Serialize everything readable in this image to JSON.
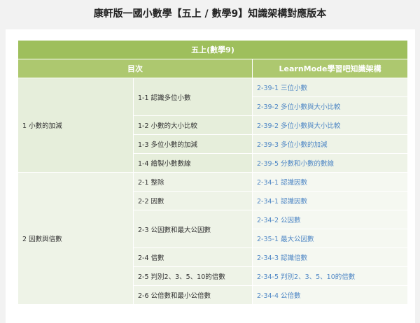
{
  "title": "康軒版一國小數學【五上 / 數學9】知識架構對應版本",
  "table": {
    "header": "五上(數學9)",
    "col_toc": "目次",
    "col_map": "LearnMode學習吧知識架構",
    "groups": [
      {
        "unit": "1 小數的加減",
        "lessons": [
          {
            "name": "1-1 認識多位小數",
            "links": [
              "2-39-1 三位小數",
              "2-39-2 多位小數與大小比較"
            ]
          },
          {
            "name": "1-2 小數的大小比較",
            "links": [
              "2-39-2 多位小數與大小比較"
            ]
          },
          {
            "name": "1-3 多位小數的加減",
            "links": [
              "2-39-3 多位小數的加減"
            ]
          },
          {
            "name": "1-4 繪製小數數線",
            "links": [
              "2-39-5 分數和小數的數線"
            ]
          }
        ]
      },
      {
        "unit": "2 因數與倍數",
        "lessons": [
          {
            "name": "2-1 整除",
            "links": [
              "2-34-1 認識因數"
            ]
          },
          {
            "name": "2-2 因數",
            "links": [
              "2-34-1 認識因數"
            ]
          },
          {
            "name": "2-3 公因數和最大公因數",
            "links": [
              "2-34-2 公因數",
              "2-35-1 最大公因數"
            ]
          },
          {
            "name": "2-4 倍數",
            "links": [
              "2-34-3 認識倍數"
            ]
          },
          {
            "name": "2-5 判別2、3、5、10的倍數",
            "links": [
              "2-34-5 判別2、3、5、10的倍數"
            ]
          },
          {
            "name": "2-6 公倍數和最小公倍數",
            "links": [
              "2-34-4 公倍數"
            ]
          }
        ]
      }
    ]
  }
}
